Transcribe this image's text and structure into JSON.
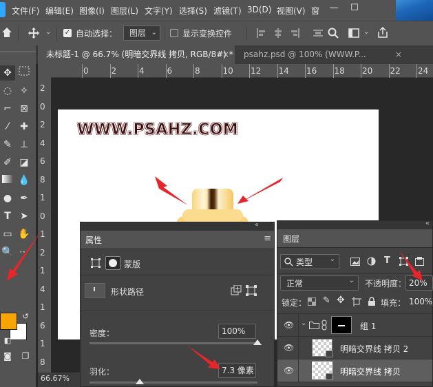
{
  "menubar": {
    "items": [
      "文件(F)",
      "编辑(E)",
      "图像(I)",
      "图层(L)",
      "文字(Y)",
      "选择(S)",
      "滤镜(T)",
      "3D(D)",
      "视图(V)",
      "窗"
    ],
    "minimize": "—",
    "maximize": "☐"
  },
  "options": {
    "auto_select_label": "自动选择：",
    "auto_select_checked": true,
    "auto_select_target": "图层",
    "show_transform_label": "显示变换控件"
  },
  "tabs": [
    {
      "label": "未标题-1 @ 66.7% (明暗交界线 拷贝, RGB/8#) *",
      "close": "×",
      "active": true
    },
    {
      "label": "psahz.psd @ 100% (WWW.P...",
      "close": "×",
      "active": false
    }
  ],
  "ruler": {
    "h_ticks": [
      "0",
      "2",
      "4",
      "6",
      "8",
      "10",
      "12",
      "14",
      "16",
      "18",
      "20",
      "22",
      "24"
    ],
    "v_ticks": [
      "2",
      "0",
      "2",
      "4",
      "6",
      "8",
      "1",
      "0",
      "1",
      "2",
      "1",
      "4",
      "1",
      "6",
      "1",
      "8"
    ]
  },
  "canvas": {
    "watermark": "WWW.PSAHZ.COM"
  },
  "status": {
    "zoom": "66.67%"
  },
  "colors": {
    "foreground": "#f7a500",
    "background": "#ffffff",
    "arrow": "#e5262b",
    "accent_blue": "#31a8ff"
  },
  "properties": {
    "title": "属性",
    "mask_label": "蒙版",
    "shape_path_label": "形状路径",
    "density_label": "密度：",
    "density_value": "100%",
    "density_fraction": 1.0,
    "feather_label": "羽化：",
    "feather_value": "7.3 像素",
    "feather_fraction": 0.3
  },
  "layers": {
    "title": "图层",
    "filter_label": "类型",
    "blend_mode": "正常",
    "opacity_label": "不透明度：",
    "opacity_value": "20%",
    "lock_label": "锁定：",
    "fill_label": "填充：",
    "fill_value": "100%",
    "rows": [
      {
        "name": "组 1",
        "type": "group"
      },
      {
        "name": "明暗交界线 拷贝 2",
        "type": "layer"
      },
      {
        "name": "明暗交界线 拷贝",
        "type": "layer",
        "selected": true
      }
    ]
  }
}
